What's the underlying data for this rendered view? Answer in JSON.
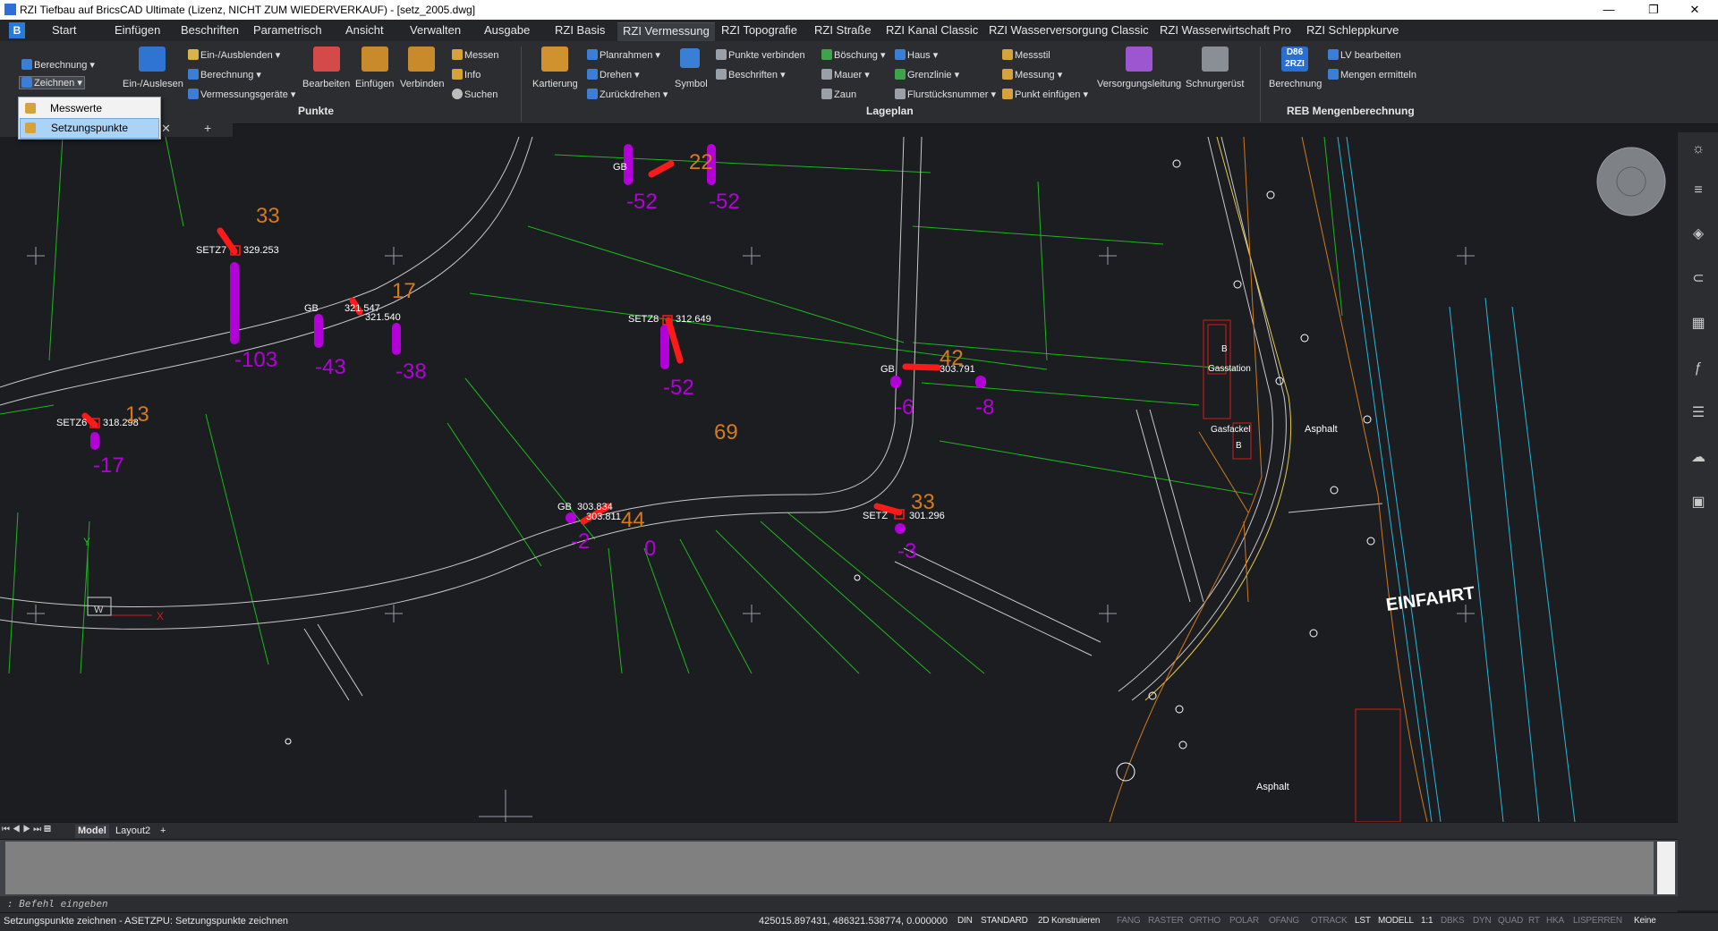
{
  "window": {
    "title": "RZI Tiefbau auf BricsCAD Ultimate (Lizenz, NICHT ZUM WIEDERVERKAUF) - [setz_2005.dwg]",
    "minimize": "—",
    "maximize": "❐",
    "close": "✕"
  },
  "menu": {
    "tabs": [
      "Start",
      "Einfügen",
      "Beschriften",
      "Parametrisch",
      "Ansicht",
      "Verwalten",
      "Ausgabe",
      "RZI Basis",
      "RZI Vermessung",
      "RZI Topografie",
      "RZI Straße",
      "RZI Kanal Classic",
      "RZI Wasserversorgung Classic",
      "RZI Wasserwirtschaft Pro",
      "RZI Schleppkurve"
    ],
    "active_index": 8
  },
  "ribbon": {
    "berechnung": "Berechnung",
    "zeichnen": "Zeichnen",
    "ein_auslesen": "Ein-/Auslesen",
    "ein_ausblenden": "Ein-/Ausblenden",
    "berechnung2": "Berechnung",
    "vermessungsgeraete": "Vermessungsgeräte",
    "bearbeiten": "Bearbeiten",
    "einfuegen": "Einfügen",
    "verbinden": "Verbinden",
    "messen": "Messen",
    "info": "Info",
    "suchen": "Suchen",
    "group_punkte": "Punkte",
    "kartierung": "Kartierung",
    "planrahmen": "Planrahmen",
    "drehen": "Drehen",
    "zurueckdrehen": "Zurückdrehen",
    "symbol": "Symbol",
    "punkte_verbinden": "Punkte verbinden",
    "beschriften": "Beschriften",
    "boeschung": "Böschung",
    "mauer": "Mauer",
    "zaun": "Zaun",
    "haus": "Haus",
    "grenzlinie": "Grenzlinie",
    "flurstuecksnummer": "Flurstücksnummer",
    "messstil": "Messstil",
    "messung": "Messung",
    "punkt_einfuegen": "Punkt einfügen",
    "versorgungsleitung": "Versorgungsleitung",
    "schnurgeruest": "Schnurgerüst",
    "group_lageplan": "Lageplan",
    "reb_berechnung": "Berechnung",
    "lv_bearbeiten": "LV bearbeiten",
    "mengen_ermitteln": "Mengen ermitteln",
    "group_reb": "REB Mengenberechnung",
    "d86": "D86 2RZI"
  },
  "dropdown": {
    "items": [
      "Messwerte",
      "Setzungspunkte"
    ],
    "selected": 1
  },
  "drawing": {
    "points": [
      {
        "name": "SETZ7",
        "elev": "329.253",
        "bar": "33",
        "diff": "-103"
      },
      {
        "name": "SETZ8",
        "elev": "312.649",
        "bar": "69",
        "diff": "-52"
      },
      {
        "name": "SETZ6",
        "elev": "318.298",
        "bar": "13",
        "diff": "-17"
      }
    ],
    "labels": {
      "gb_top": "GB",
      "top_num": "22",
      "top_diff1": "-52",
      "top_diff2": "-52",
      "gb_left": "GB",
      "gb_left_val1": "321.547",
      "gb_left_val2": "321.540",
      "left_num": "17",
      "left_diff1": "-43",
      "left_diff2": "-38",
      "gb_mid": "GB",
      "mid_val": "303.791",
      "mid_num": "42",
      "mid_diff1": "-6",
      "mid_diff2": "-8",
      "gb_low": "GB",
      "low_val1": "303.834",
      "low_val2": "303.811",
      "low_num": "44",
      "low_diff1": "-2",
      "low_diff2": "0",
      "setz_low": "SETZ",
      "setz_low_val": "301.296",
      "setz_low_num": "33",
      "setz_low_diff": "-3",
      "gasstation": "Gasstation",
      "gasfackel": "Gasfackel",
      "asphalt1": "Asphalt",
      "asphalt2": "Asphalt",
      "einfahrt": "EINFAHRT",
      "ucs_y": "Y",
      "ucs_x": "X",
      "ucs_w": "W",
      "b1": "B",
      "b2": "B"
    }
  },
  "layout_tabs": [
    "Model",
    "Layout2",
    "+"
  ],
  "command": {
    "prompt": ": Befehl eingeben"
  },
  "status": {
    "left": "Setzungspunkte zeichnen - ASETZPU: Setzungspunkte zeichnen",
    "coords": "425015.897431, 486321.538774, 0.000000",
    "toggles": [
      "DIN",
      "STANDARD",
      "2D Konstruieren",
      "FANG",
      "RASTER",
      "ORTHO",
      "POLAR",
      "OFANG",
      "OTRACK",
      "LST",
      "MODELL",
      "1:1",
      "DBKS",
      "DYN",
      "QUAD",
      "RT",
      "HKA",
      "LISPERREN",
      "Keine"
    ],
    "on": [
      "DIN",
      "STANDARD",
      "2D Konstruieren",
      "LST",
      "MODELL",
      "1:1",
      "Keine"
    ]
  },
  "colors": {
    "bg": "#1b1d21",
    "line_green": "#1fb51f",
    "road_gray": "#c8c8c8",
    "bar_magenta": "#b400d8",
    "marker_red": "#ff1a1a",
    "label_orange": "#d67a1a",
    "accent_blue": "#2a7bd8"
  }
}
